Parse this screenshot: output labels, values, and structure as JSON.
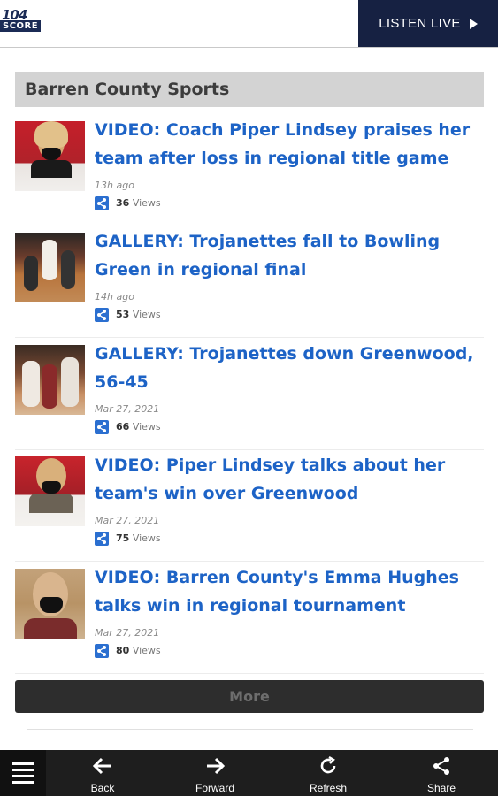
{
  "header": {
    "logo_top": "104",
    "logo_bottom": "SCORE",
    "listen_live": "LISTEN LIVE"
  },
  "section": {
    "title": "Barren County Sports"
  },
  "articles": [
    {
      "headline": "VIDEO: Coach Piper Lindsey praises her team after loss in regional title game",
      "time": "13h ago",
      "views": "36",
      "views_label": "Views"
    },
    {
      "headline": "GALLERY: Trojanettes fall to Bowling Green in regional final",
      "time": "14h ago",
      "views": "53",
      "views_label": "Views"
    },
    {
      "headline": "GALLERY: Trojanettes down Greenwood, 56-45",
      "time": "Mar 27, 2021",
      "views": "66",
      "views_label": "Views"
    },
    {
      "headline": "VIDEO: Piper Lindsey talks about her team's win over Greenwood",
      "time": "Mar 27, 2021",
      "views": "75",
      "views_label": "Views"
    },
    {
      "headline": "VIDEO: Barren County's Emma Hughes talks win in regional tournament",
      "time": "Mar 27, 2021",
      "views": "80",
      "views_label": "Views"
    }
  ],
  "more_label": "More",
  "bottom_nav": {
    "back": "Back",
    "forward": "Forward",
    "refresh": "Refresh",
    "share": "Share"
  },
  "colors": {
    "headline": "#1d63c6",
    "header_bg": "#162142",
    "bottom_bar": "#1e1e1e",
    "section_bg": "#d3d3d3"
  }
}
